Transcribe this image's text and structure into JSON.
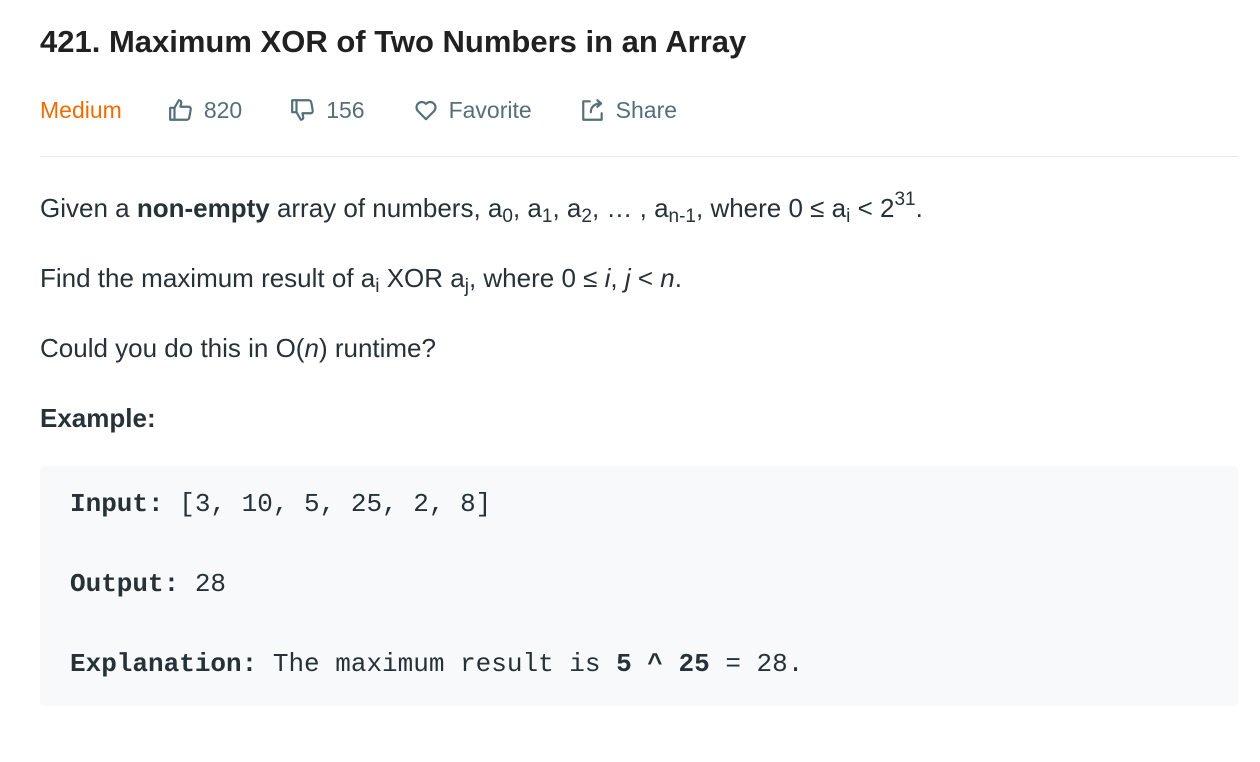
{
  "problem": {
    "title": "421. Maximum XOR of Two Numbers in an Array",
    "difficulty": "Medium",
    "likes": "820",
    "dislikes": "156",
    "favorite_label": "Favorite",
    "share_label": "Share"
  },
  "description": {
    "p1_a": "Given a ",
    "p1_b": "non-empty",
    "p1_c": " array of numbers, a",
    "p1_sub0": "0",
    "p1_d": ", a",
    "p1_sub1": "1",
    "p1_e": ", a",
    "p1_sub2": "2",
    "p1_f": ", … , a",
    "p1_subn": "n-1",
    "p1_g": ", where 0 ≤ a",
    "p1_subi": "i",
    "p1_h": " < 2",
    "p1_sup": "31",
    "p1_end": ".",
    "p2_a": "Find the maximum result of a",
    "p2_subi": "i",
    "p2_b": " XOR a",
    "p2_subj": "j",
    "p2_c": ", where 0 ≤ ",
    "p2_i": "i",
    "p2_d": ", ",
    "p2_j": "j",
    "p2_e": " < ",
    "p2_n": "n",
    "p2_end": ".",
    "p3_a": "Could you do this in O(",
    "p3_n": "n",
    "p3_b": ") runtime?",
    "example_title": "Example:"
  },
  "example": {
    "input_label": "Input:",
    "input_value": " [3, 10, 5, 25, 2, 8]",
    "output_label": "Output:",
    "output_value": " 28",
    "explanation_label": "Explanation:",
    "explanation_text": " The maximum result is ",
    "explanation_expr": "5 ^ 25",
    "explanation_end": " = 28."
  },
  "colors": {
    "difficulty": "#ef6c00",
    "meta_text": "#546e7a",
    "code_background": "#f7f9fa"
  },
  "icons": [
    "thumbs-up-icon",
    "thumbs-down-icon",
    "heart-icon",
    "share-icon"
  ]
}
